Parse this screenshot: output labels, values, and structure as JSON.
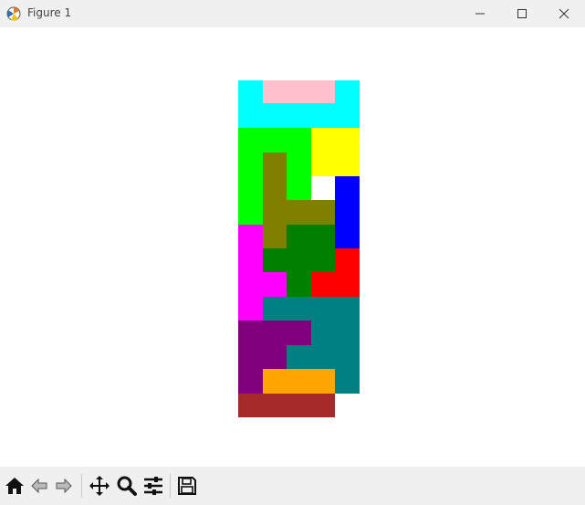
{
  "window": {
    "title": "Figure 1",
    "controls": [
      "minimize",
      "maximize",
      "close"
    ]
  },
  "toolbar": {
    "buttons": [
      "home-icon",
      "back-arrow-icon",
      "forward-arrow-icon",
      "pan-icon",
      "zoom-icon",
      "configure-subplots-icon",
      "save-icon"
    ]
  },
  "figure": {
    "description_colors": {
      "cyan": "#00ffff",
      "pink": "#ffc0cb",
      "green": "#00ff00",
      "yellow": "#ffff00",
      "olive": "#808000",
      "blue": "#0000ff",
      "magenta": "#ff00ff",
      "dark_green": "#008000",
      "red": "#ff0000",
      "teal": "#008080",
      "purple": "#800080",
      "orange": "#ffa500",
      "brown": "#a52a2a"
    }
  }
}
